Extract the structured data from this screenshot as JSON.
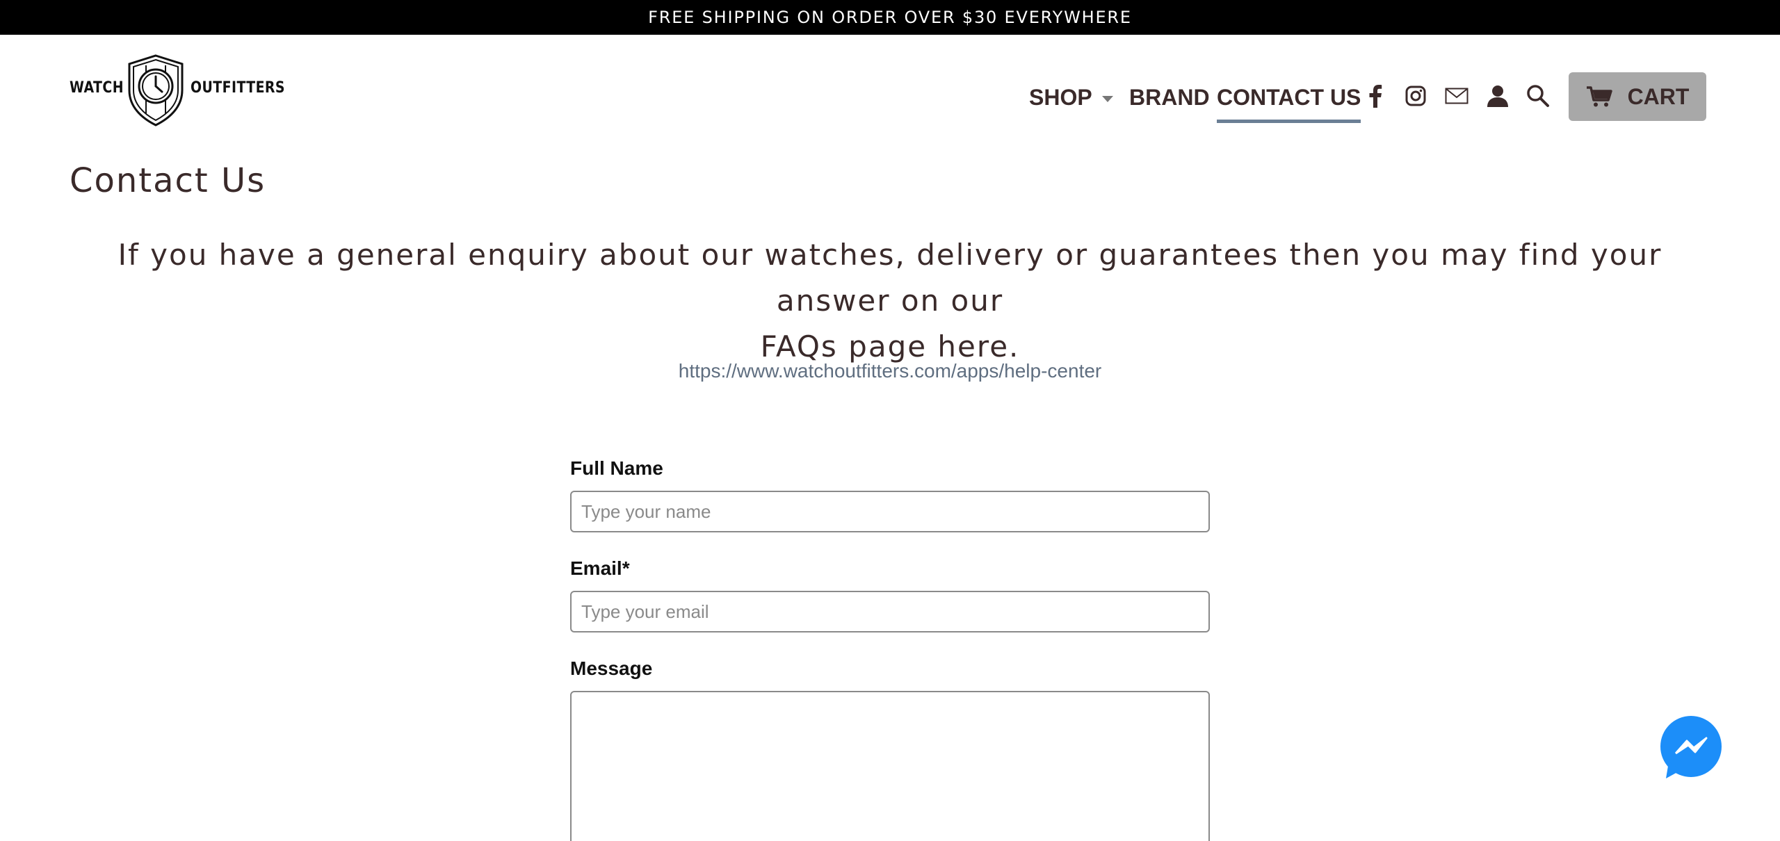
{
  "announcement": {
    "text": "FREE SHIPPING ON ORDER OVER $30 EVERYWHERE"
  },
  "brand": {
    "word_left": "WATCH",
    "word_right": "OUTFITTERS"
  },
  "nav": {
    "shop": "SHOP",
    "brand": "BRAND",
    "contact": "CONTACT US",
    "active": "contact",
    "icons": [
      "facebook-icon",
      "instagram-icon",
      "mail-icon",
      "account-icon",
      "search-icon"
    ],
    "cart_label": "CART"
  },
  "page": {
    "title": "Contact Us",
    "intro_line1": "If you have a general enquiry about our watches, delivery or guarantees then you may find your answer on our",
    "intro_line2": "FAQs page here.",
    "help_link": "https://www.watchoutfitters.com/apps/help-center"
  },
  "form": {
    "name_label": "Full Name",
    "name_placeholder": "Type your name",
    "name_value": "",
    "email_label": "Email*",
    "email_placeholder": "Type your email",
    "email_value": "",
    "message_label": "Message",
    "message_value": ""
  },
  "colors": {
    "announcement_bg": "#000000",
    "text_primary": "#3a2a2a",
    "link": "#5f6e80",
    "nav_active_underline": "#6b7f95",
    "cart_bg": "#a8a8a8",
    "messenger_blue": "#1c8ef9"
  },
  "widget": {
    "icon": "messenger-icon"
  }
}
